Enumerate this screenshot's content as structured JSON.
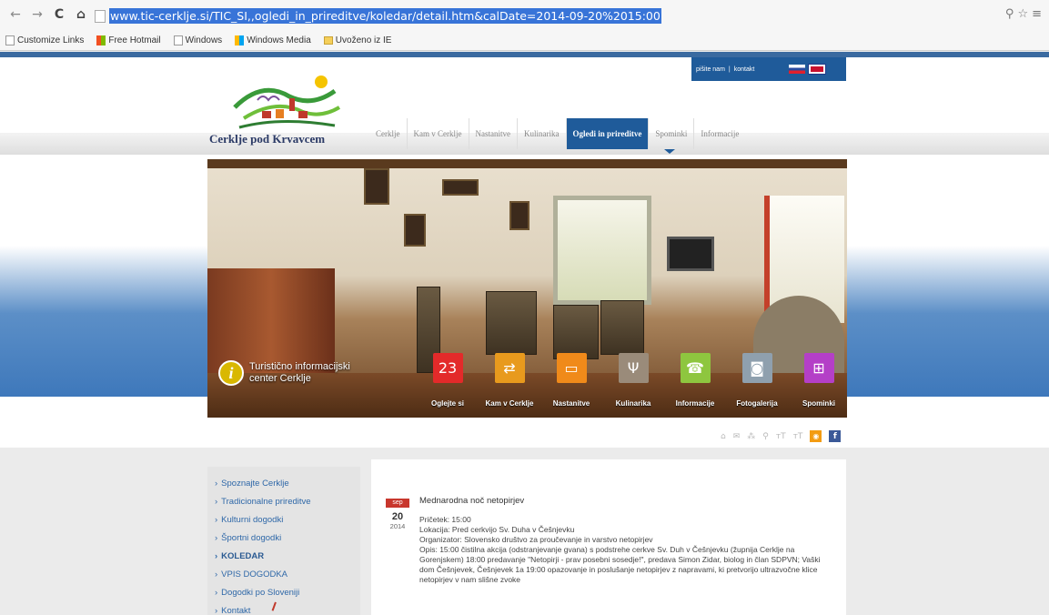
{
  "browser": {
    "url": "www.tic-cerklje.si/TIC_SI,,ogledi_in_prireditve/koledar/detail.htm&calDate=2014-09-20%2015:00",
    "bookmarks": [
      "Customize Links",
      "Free Hotmail",
      "Windows",
      "Windows Media",
      "Uvoženo iz IE"
    ]
  },
  "header": {
    "toplinks": [
      "pišite nam",
      "kontakt"
    ],
    "logo_text": "Cerklje pod Krvavcem",
    "nav": [
      "Cerklje",
      "Kam v Cerklje",
      "Nastanitve",
      "Kulinarika",
      "Ogledi in prireditve",
      "Spominki",
      "Informacije"
    ],
    "nav_active": "Ogledi in prireditve"
  },
  "hero": {
    "info_text": "Turistično informacijski center Cerklje",
    "tiles": [
      {
        "label": "Oglejte si",
        "color": "#e32a2a",
        "icon": "calendar-icon",
        "glyph": "23"
      },
      {
        "label": "Kam v Cerklje",
        "color": "#e89a1d",
        "icon": "signpost-icon",
        "glyph": "⇄"
      },
      {
        "label": "Nastanitve",
        "color": "#f08a1a",
        "icon": "bed-icon",
        "glyph": "▭"
      },
      {
        "label": "Kulinarika",
        "color": "#9a8b7a",
        "icon": "cutlery-icon",
        "glyph": "Ψ"
      },
      {
        "label": "Informacije",
        "color": "#8ec63f",
        "icon": "phone-icon",
        "glyph": "☎"
      },
      {
        "label": "Fotogalerija",
        "color": "#8fa0ae",
        "icon": "camera-icon",
        "glyph": "◙"
      },
      {
        "label": "Spominki",
        "color": "#b43fc7",
        "icon": "gift-icon",
        "glyph": "⊞"
      }
    ]
  },
  "sidebar": {
    "items": [
      {
        "label": "Spoznajte Cerklje",
        "bold": false
      },
      {
        "label": "Tradicionalne prireditve",
        "bold": false
      },
      {
        "label": "Kulturni dogodki",
        "bold": false
      },
      {
        "label": "Športni dogodki",
        "bold": false
      },
      {
        "label": "KOLEDAR",
        "bold": true
      },
      {
        "label": "VPIS DOGODKA",
        "bold": false
      },
      {
        "label": "Dogodki po Sloveniji",
        "bold": false
      },
      {
        "label": "Kontakt",
        "bold": false
      }
    ]
  },
  "event": {
    "month": "sep",
    "day": "20",
    "year": "2014",
    "title": "Mednarodna noč netopirjev",
    "start": "Pričetek: 15:00",
    "location": "Lokacija: Pred cerkvijo Sv. Duha v Češnjevku",
    "organizer": "Organizator: Slovensko društvo za proučevanje in varstvo netopirjev",
    "description": "Opis: 15:00 čistilna akcija (odstranjevanje gvana) s podstrehe cerkve Sv. Duh v Češnjevku (župnija Cerklje na Gorenjskem) 18:00 predavanje \"Netopirji - prav posebni sosedje!\", predava Simon Zidar, biolog in član SDPVN; Vaški dom Češnjevek, Češnjevek 1a 19:00 opazovanje in poslušanje netopirjev z napravami, ki pretvorijo ultrazvočne klice netopirjev v nam slišne zvoke"
  }
}
